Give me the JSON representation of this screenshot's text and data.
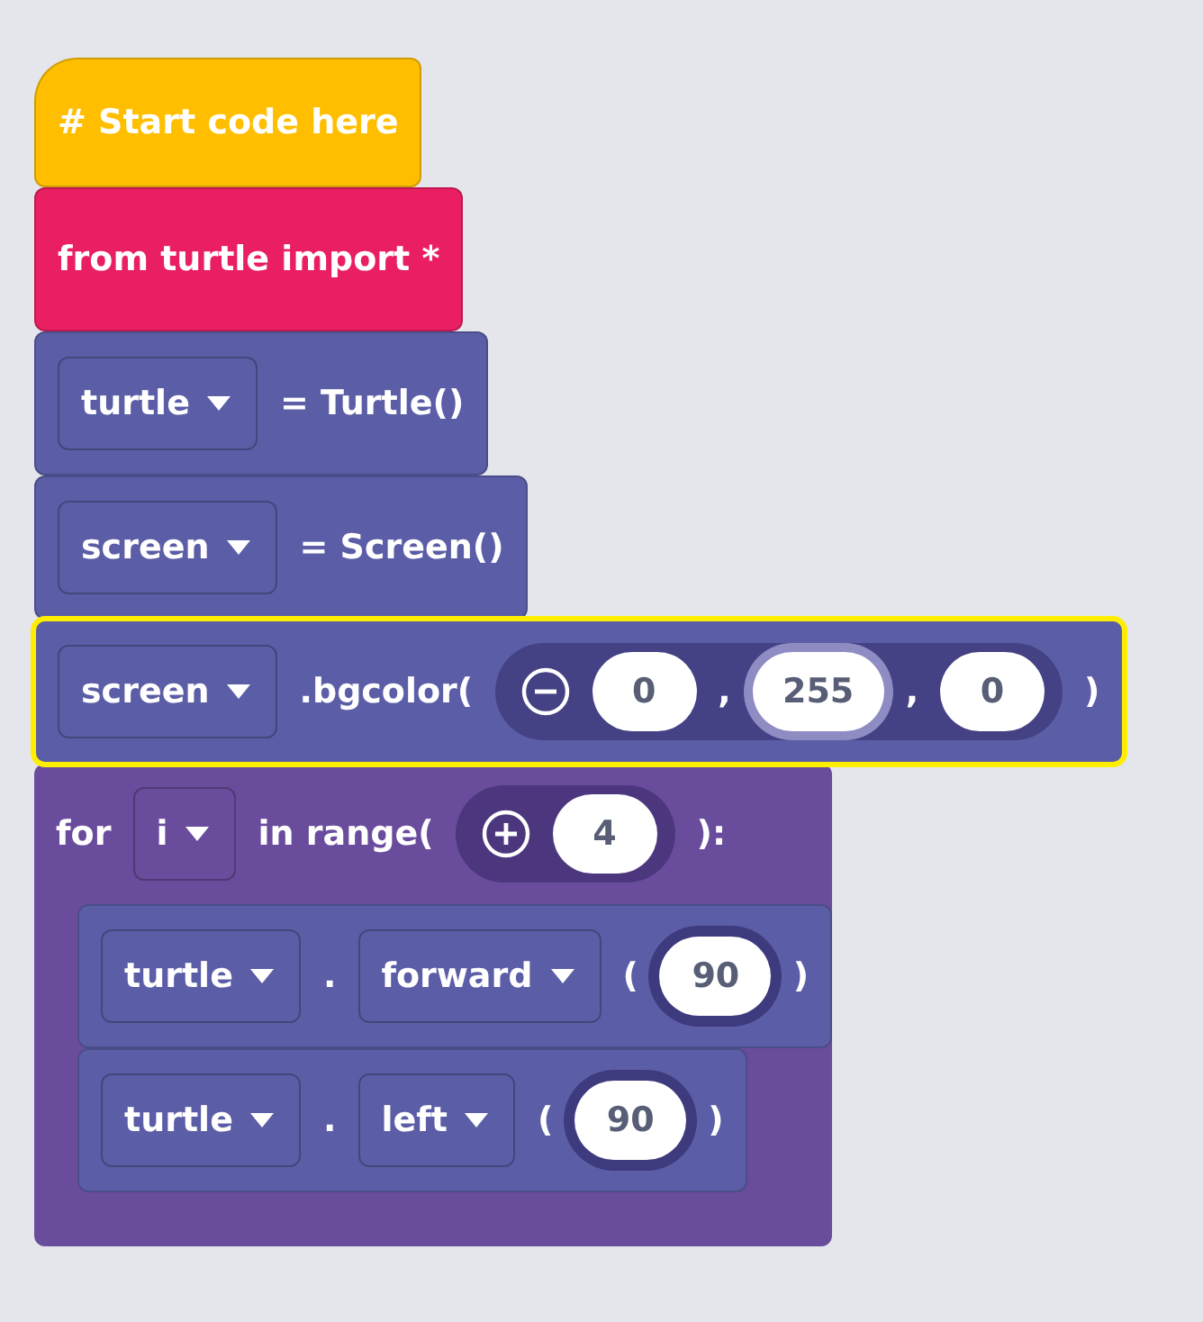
{
  "blocks": [
    {
      "kind": "hat",
      "color": "#ffbf00",
      "selected": false,
      "parts": [
        {
          "kind": "label",
          "text": "# Start code here"
        }
      ]
    },
    {
      "kind": "statement",
      "color": "#e91e63",
      "selected": false,
      "parts": [
        {
          "kind": "label",
          "text": "from turtle import *"
        }
      ]
    },
    {
      "kind": "statement",
      "color": "#5b5ea6",
      "selected": false,
      "parts": [
        {
          "kind": "dropdown",
          "text": "turtle"
        },
        {
          "kind": "label",
          "text": "= Turtle()"
        }
      ]
    },
    {
      "kind": "statement",
      "color": "#5b5ea6",
      "selected": false,
      "parts": [
        {
          "kind": "dropdown",
          "text": "screen"
        },
        {
          "kind": "label",
          "text": "= Screen()"
        }
      ]
    },
    {
      "kind": "statement",
      "color": "#5b5ea6",
      "selected": true,
      "parts": [
        {
          "kind": "dropdown",
          "text": "screen"
        },
        {
          "kind": "label",
          "text": ".bgcolor("
        },
        {
          "kind": "tuple-minus",
          "parts": [
            {
              "kind": "number",
              "text": "0",
              "focused": false
            },
            {
              "kind": "label",
              "text": ","
            },
            {
              "kind": "number",
              "text": "255",
              "focused": true
            },
            {
              "kind": "label",
              "text": ","
            },
            {
              "kind": "number",
              "text": "0",
              "focused": false
            }
          ]
        },
        {
          "kind": "label",
          "text": ")"
        }
      ]
    },
    {
      "kind": "loop",
      "color": "#6a4c9c",
      "selected": false,
      "parts": [
        {
          "kind": "label",
          "text": "for"
        },
        {
          "kind": "dropdown",
          "text": "i"
        },
        {
          "kind": "label",
          "text": "in range("
        },
        {
          "kind": "tuple-plus",
          "parts": [
            {
              "kind": "number",
              "text": "4",
              "focused": false
            }
          ]
        },
        {
          "kind": "label",
          "text": "):"
        }
      ],
      "children": [
        {
          "kind": "statement",
          "color": "#5b5ea6",
          "selected": false,
          "parts": [
            {
              "kind": "dropdown",
              "text": "turtle"
            },
            {
              "kind": "label",
              "text": "."
            },
            {
              "kind": "dropdown",
              "text": "forward"
            },
            {
              "kind": "label",
              "text": "("
            },
            {
              "kind": "slot",
              "text": "90"
            },
            {
              "kind": "label",
              "text": ")"
            }
          ]
        },
        {
          "kind": "statement",
          "color": "#5b5ea6",
          "selected": false,
          "parts": [
            {
              "kind": "dropdown",
              "text": "turtle"
            },
            {
              "kind": "label",
              "text": "."
            },
            {
              "kind": "dropdown",
              "text": "left"
            },
            {
              "kind": "label",
              "text": "("
            },
            {
              "kind": "slot",
              "text": "90"
            },
            {
              "kind": "label",
              "text": ")"
            }
          ]
        }
      ]
    }
  ]
}
